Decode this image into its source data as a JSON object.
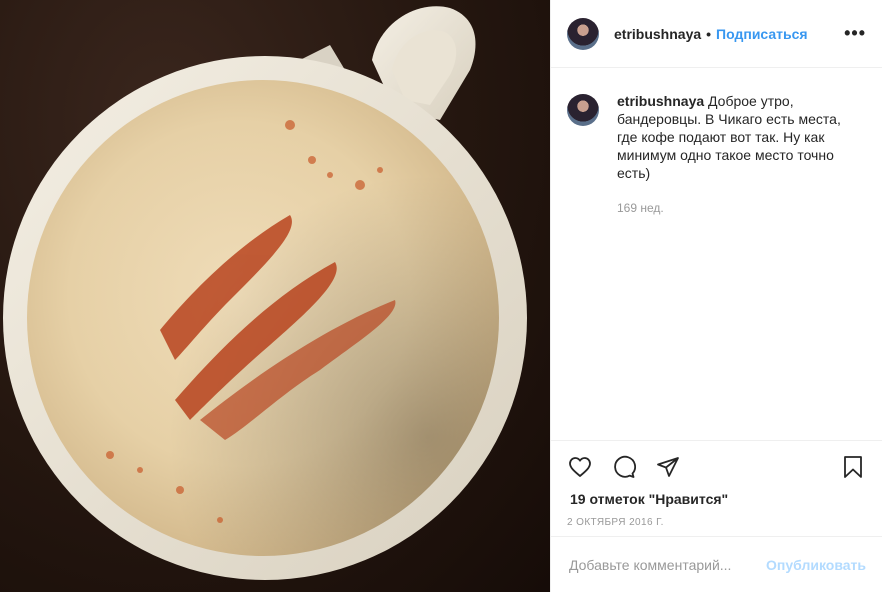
{
  "post": {
    "username": "etribushnaya",
    "separator": "•",
    "follow_label": "Подписаться",
    "more_label": "•••",
    "caption_username": "etribushnaya",
    "caption_text": "Доброе утро, бандеровцы. В Чикаго есть места, где кофе подают вот так. Ну как минимум одно такое место точно есть)",
    "caption_time": "169 нед.",
    "likes": "19 отметок \"Нравится\"",
    "date": "2 ОКТЯБРЯ 2016 Г.",
    "comment_placeholder": "Добавьте комментарий...",
    "publish_label": "Опубликовать",
    "icons": [
      "heart-icon",
      "comment-icon",
      "share-icon",
      "bookmark-icon"
    ],
    "colors": {
      "accent": "#3897f0",
      "publish_disabled": "#b3dbff",
      "muted": "#999999"
    }
  }
}
